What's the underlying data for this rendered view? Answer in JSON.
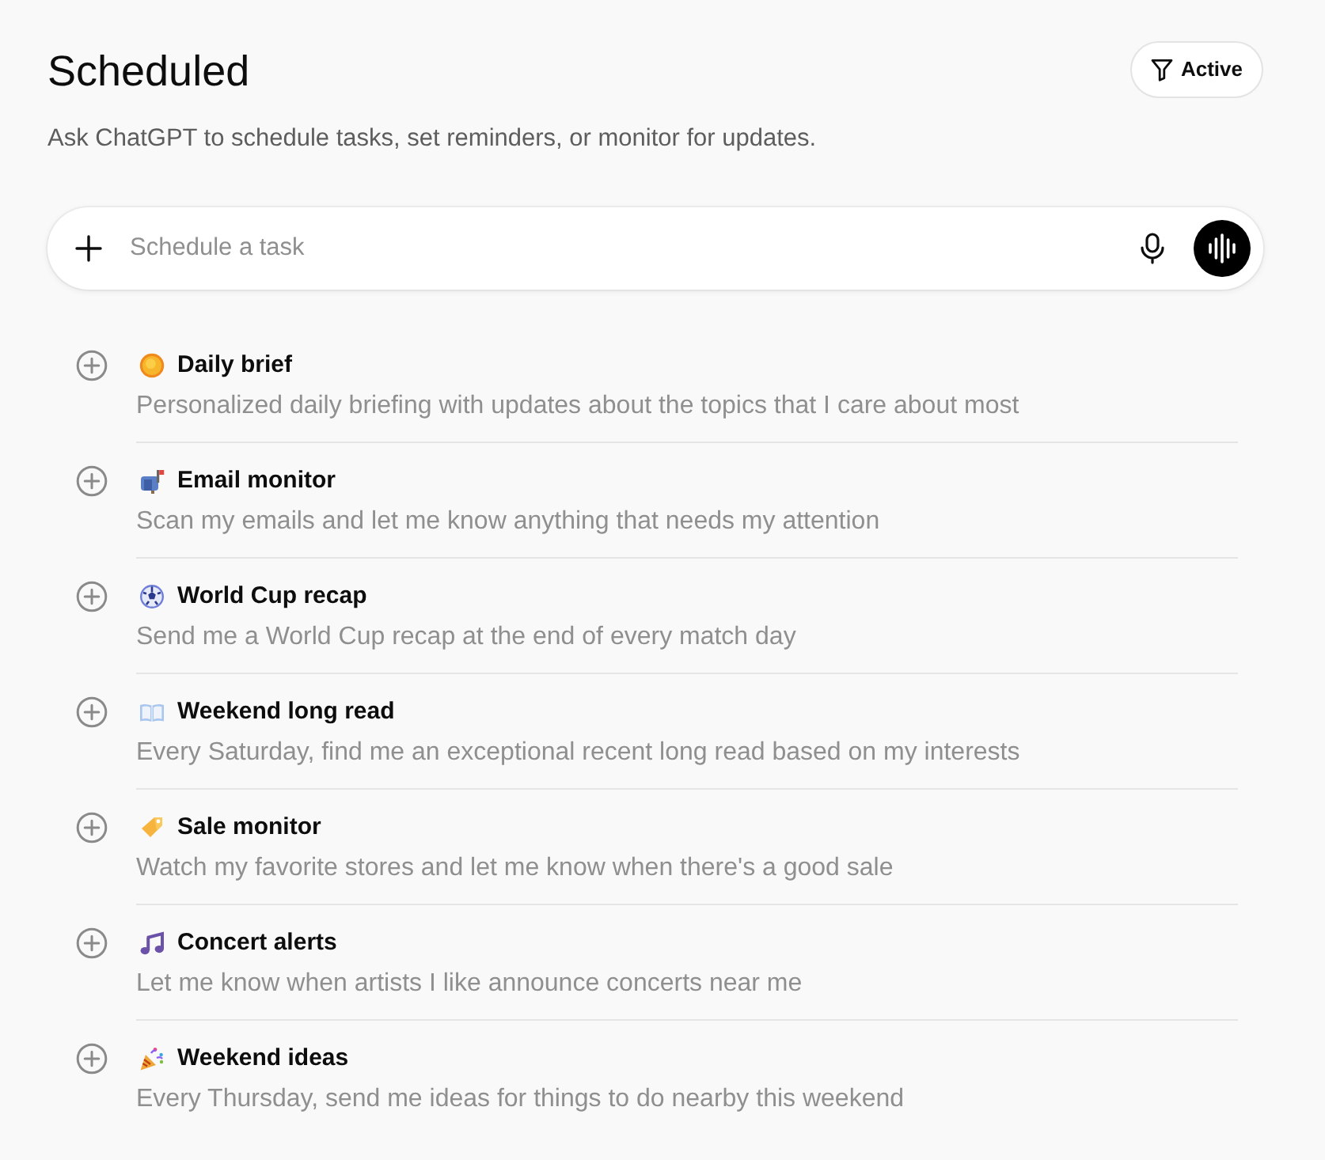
{
  "page": {
    "title": "Scheduled",
    "subtitle": "Ask ChatGPT to schedule tasks, set reminders, or monitor for updates."
  },
  "filter_button": {
    "label": "Active"
  },
  "task_input": {
    "placeholder": "Schedule a task"
  },
  "suggestions": [
    {
      "title": "Daily brief",
      "description": "Personalized daily briefing with updates about the topics that I care about most"
    },
    {
      "title": "Email monitor",
      "description": "Scan my emails and let me know anything that needs my attention"
    },
    {
      "title": "World Cup recap",
      "description": "Send me a World Cup recap at the end of every match day"
    },
    {
      "title": "Weekend long read",
      "description": "Every Saturday, find me an exceptional recent long read based on my interests"
    },
    {
      "title": "Sale monitor",
      "description": "Watch my favorite stores and let me know when there's a good sale"
    },
    {
      "title": "Concert alerts",
      "description": "Let me know when artists I like announce concerts near me"
    },
    {
      "title": "Weekend ideas",
      "description": "Every Thursday, send me ideas for things to do nearby this weekend"
    }
  ]
}
